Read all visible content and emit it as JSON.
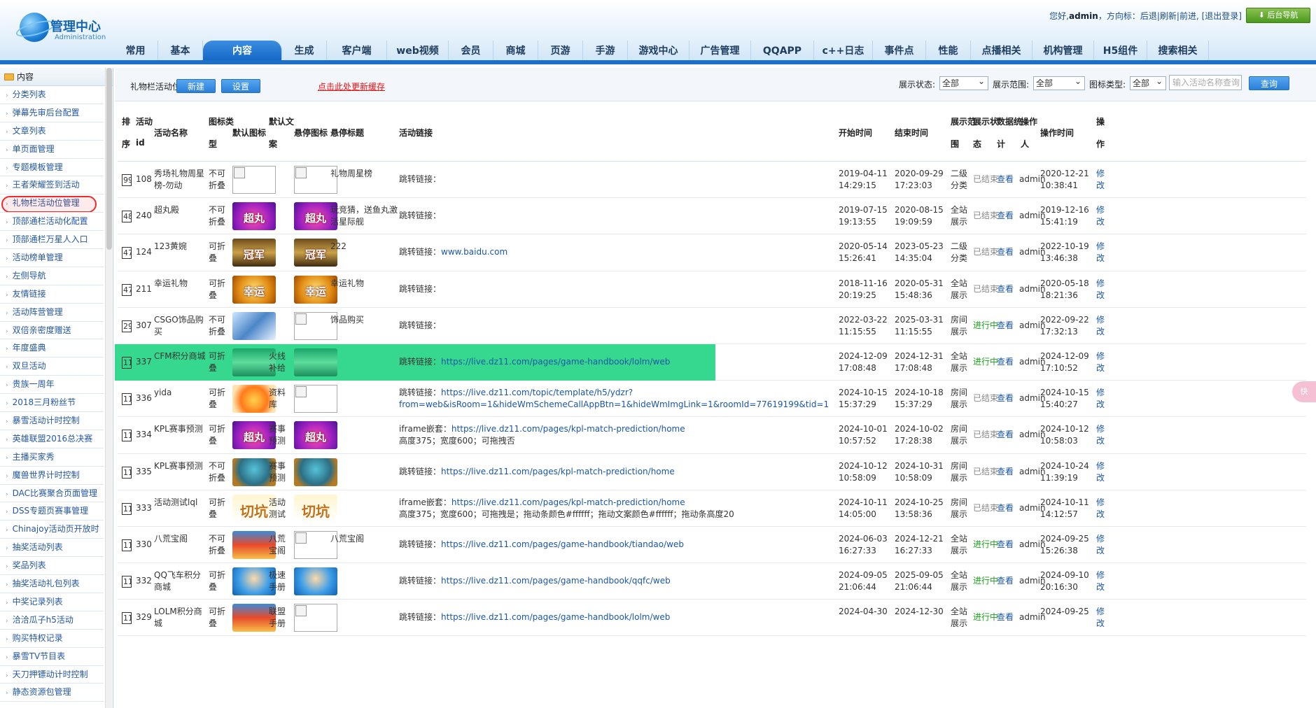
{
  "header": {
    "logo_title": "管理中心",
    "logo_subtitle": "Administration",
    "greeting": "您好,",
    "user": "admin",
    "nav_prefix": "，方向标：",
    "back_link": "后退",
    "refresh_link": "刷新",
    "forward_link": "前进",
    "logout_link": "[退出登录]",
    "backend_nav_button": "后台导航",
    "tabs": [
      "常用",
      "基本",
      "内容",
      "生成",
      "客户端",
      "web视频",
      "会员",
      "商城",
      "页游",
      "手游",
      "游戏中心",
      "广告管理",
      "QQAPP",
      "c++日志",
      "事件点",
      "性能",
      "点播相关",
      "机构管理",
      "H5组件",
      "搜索相关"
    ],
    "active_tab": "内容"
  },
  "sidebar": {
    "section_title": "内容",
    "items": [
      "分类列表",
      "弹幕先审后台配置",
      "文章列表",
      "单页面管理",
      "专题模板管理",
      "王者荣耀签到活动",
      "礼物栏活动位管理",
      "顶部通栏活动化配置",
      "顶部通栏万星人入口",
      "活动榜单管理",
      "左侧导航",
      "友情链接",
      "活动阵营管理",
      "双倍亲密度赠送",
      "年度盛典",
      "双旦活动",
      "贵族一周年",
      "2018三月粉丝节",
      "暴雪活动计时控制",
      "英雄联盟2016总决赛",
      "主播买家秀",
      "魔兽世界计时控制",
      "DAC比赛聚合页面管理",
      "DSS专题页赛事管理",
      "Chinajoy活动页开放时",
      "抽奖活动列表",
      "奖品列表",
      "抽奖活动礼包列表",
      "中奖记录列表",
      "洽洽瓜子h5活动",
      "购买特权记录",
      "暴雪TV节目表",
      "天刀押镖动计时控制",
      "静态资源包管理"
    ]
  },
  "toolbar": {
    "page_label": "礼物栏活动位管理",
    "new_button": "新建",
    "settings_button": "设置",
    "cache_link": "点击此处更新缓存",
    "filter_status_label": "展示状态:",
    "filter_status_value": "全部",
    "filter_range_label": "展示范围:",
    "filter_range_value": "全部",
    "filter_icon_label": "图标类型:",
    "filter_icon_value": "全部",
    "search_placeholder": "输入活动名称查询",
    "query_button": "查询"
  },
  "table": {
    "headers": {
      "seq": [
        "排",
        "序"
      ],
      "id": [
        "活动",
        "id"
      ],
      "name": "活动名称",
      "icon_type": [
        "图标类",
        "型"
      ],
      "default_icon": "默认图标",
      "default_text": [
        "默认文",
        "案"
      ],
      "hover_icon": "悬停图标",
      "hover_title": "悬停标题",
      "link": "活动链接",
      "start": "开始时间",
      "end": "结束时间",
      "range": [
        "展示范",
        "围"
      ],
      "status": [
        "展示状",
        "态"
      ],
      "stats": [
        "数据统",
        "计"
      ],
      "operator": [
        "操作",
        "人"
      ],
      "optime": "操作时间",
      "action": [
        "操",
        "作"
      ]
    },
    "rows": [
      {
        "seq": "99",
        "id": "108",
        "name": "秀场礼物周星榜-勿动",
        "icon_type": "不可折叠",
        "default_icon": "blank",
        "default_text": "",
        "hover_icon": "blank",
        "hover_title": "礼物周星榜",
        "link_prefix": "跳转链接：",
        "link_url": "",
        "link_line2": "",
        "start": [
          "2019-04-11",
          "14:29:15"
        ],
        "end": [
          "2020-09-29",
          "17:23:03"
        ],
        "range": "二级分类",
        "status": "已结束",
        "stats": "查看",
        "operator": "admin",
        "optime": [
          "2020-12-21",
          "10:38:41"
        ],
        "action": "修改"
      },
      {
        "seq": "48",
        "id": "240",
        "name": "超丸殿",
        "icon_type": "不可折叠",
        "default_icon": "超丸",
        "default_text": "",
        "hover_icon": "超丸",
        "hover_title": "玩竞猜，送鱼丸激活星际舰",
        "link_prefix": "跳转链接：",
        "link_url": "",
        "link_line2": "",
        "start": [
          "2019-07-15",
          "19:13:55"
        ],
        "end": [
          "2020-08-15",
          "19:09:59"
        ],
        "range": "全站展示",
        "status": "已结束",
        "stats": "查看",
        "operator": "admin",
        "optime": [
          "2019-12-16",
          "15:41:19"
        ],
        "action": "修改"
      },
      {
        "seq": "47",
        "id": "124",
        "name": "123黄婉",
        "icon_type": "可折叠",
        "default_icon": "冠军",
        "default_text": "",
        "hover_icon": "冠军",
        "hover_title": "222",
        "link_prefix": "跳转链接：",
        "link_url": "www.baidu.com",
        "link_line2": "",
        "start": [
          "2020-05-14",
          "15:26:41"
        ],
        "end": [
          "2023-05-23",
          "14:35:04"
        ],
        "range": "二级分类",
        "status": "已结束",
        "stats": "查看",
        "operator": "admin",
        "optime": [
          "2022-10-19",
          "13:46:38"
        ],
        "action": "修改"
      },
      {
        "seq": "47",
        "id": "211",
        "name": "幸运礼物",
        "icon_type": "可折叠",
        "default_icon": "幸运",
        "default_text": "",
        "hover_icon": "幸运",
        "hover_title": "幸运礼物",
        "link_prefix": "跳转链接：",
        "link_url": "",
        "link_line2": "",
        "start": [
          "2018-11-16",
          "20:19:25"
        ],
        "end": [
          "2020-05-31",
          "15:48:36"
        ],
        "range": "全站展示",
        "status": "已结束",
        "stats": "查看",
        "operator": "admin",
        "optime": [
          "2020-05-18",
          "18:21:36"
        ],
        "action": "修改"
      },
      {
        "seq": "29",
        "id": "307",
        "name": "CSGO饰品购买",
        "icon_type": "不可折叠",
        "default_icon": "csgo",
        "default_text": "",
        "hover_icon": "blank",
        "hover_title": "饰品购买",
        "link_prefix": "跳转链接：",
        "link_url": "",
        "link_line2": "",
        "start": [
          "2022-03-22",
          "11:15:55"
        ],
        "end": [
          "2025-03-31",
          "11:15:55"
        ],
        "range": "房间展示",
        "status": "进行中",
        "stats": "查看",
        "operator": "admin",
        "optime": [
          "2022-09-22",
          "17:32:13"
        ],
        "action": "修改"
      },
      {
        "seq": "11",
        "id": "337",
        "name": "CFM积分商城",
        "icon_type": "可折叠",
        "default_icon": "green",
        "default_text": "火线补给",
        "hover_icon": "green",
        "hover_title": "",
        "link_prefix": "跳转链接：",
        "link_url": "https://live.dz11.com/pages/game-handbook/lolm/web",
        "link_line2": "",
        "start": [
          "2024-12-09",
          "17:08:48"
        ],
        "end": [
          "2024-12-31",
          "17:08:48"
        ],
        "range": "全站展示",
        "status": "进行中",
        "stats": "查看",
        "operator": "admin",
        "optime": [
          "2024-12-09",
          "17:10:52"
        ],
        "action": "修改",
        "highlight": true
      },
      {
        "seq": "11",
        "id": "336",
        "name": "yida",
        "icon_type": "可折叠",
        "default_icon": "sun",
        "default_text": "资料库",
        "hover_icon": "blank",
        "hover_title": "",
        "link_prefix": "跳转链接：",
        "link_url": "https://live.dz11.com/topic/template/h5/ydzr?",
        "link_line2": "from=web&isRoom=1&hideWmSchemeCallAppBtn=1&hideWmImgLink=1&roomId=77619199&tid=1",
        "start": [
          "2024-10-15",
          "15:37:29"
        ],
        "end": [
          "2024-10-18",
          "15:37:29"
        ],
        "range": "房间展示",
        "status": "已结束",
        "stats": "查看",
        "operator": "admin",
        "optime": [
          "2024-10-15",
          "15:40:27"
        ],
        "action": "修改"
      },
      {
        "seq": "11",
        "id": "334",
        "name": "KPL赛事预测",
        "icon_type": "可折叠",
        "default_icon": "超丸",
        "default_text": "赛事预测",
        "hover_icon": "超丸",
        "hover_title": "",
        "link_prefix": "iframe嵌套：",
        "link_url": "https://live.dz11.com/pages/kpl-match-prediction/home",
        "link_line2": "高度375；宽度600；可拖拽否",
        "start": [
          "2024-10-01",
          "10:57:52"
        ],
        "end": [
          "2024-10-02",
          "17:28:38"
        ],
        "range": "房间展示",
        "status": "已结束",
        "stats": "查看",
        "operator": "admin",
        "optime": [
          "2024-10-12",
          "10:58:03"
        ],
        "action": "修改"
      },
      {
        "seq": "11",
        "id": "335",
        "name": "KPL赛事预测",
        "icon_type": "不可折叠",
        "default_icon": "helmet",
        "default_text": "赛事预测",
        "hover_icon": "helmet",
        "hover_title": "",
        "link_prefix": "跳转链接：",
        "link_url": "https://live.dz11.com/pages/kpl-match-prediction/home",
        "link_line2": "",
        "start": [
          "2024-10-12",
          "10:58:09"
        ],
        "end": [
          "2024-10-31",
          "10:58:09"
        ],
        "range": "房间展示",
        "status": "已结束",
        "stats": "查看",
        "operator": "admin",
        "optime": [
          "2024-10-24",
          "11:39:19"
        ],
        "action": "修改"
      },
      {
        "seq": "11",
        "id": "333",
        "name": "活动测试lql",
        "icon_type": "可折叠",
        "default_icon": "切坑",
        "default_text": "活动测试",
        "hover_icon": "切坑",
        "hover_title": "",
        "link_prefix": "iframe嵌套：",
        "link_url": "https://live.dz11.com/pages/kpl-match-prediction/home",
        "link_line2": "高度375；宽度600；可拖拽是；拖动条颜色#ffffff；拖动文案颜色#ffffff；拖动条高度20",
        "start": [
          "2024-10-11",
          "14:05:00"
        ],
        "end": [
          "2024-10-25",
          "13:58:36"
        ],
        "range": "房间展示",
        "status": "已结束",
        "stats": "查看",
        "operator": "admin",
        "optime": [
          "2024-10-11",
          "14:12:57"
        ],
        "action": "修改"
      },
      {
        "seq": "11",
        "id": "330",
        "name": "八荒宝阁",
        "icon_type": "不可折叠",
        "default_icon": "temple",
        "default_text": "八荒宝阁",
        "hover_icon": "blank",
        "hover_title": "八荒宝阁",
        "link_prefix": "跳转链接：",
        "link_url": "https://live.dz11.com/pages/game-handbook/tiandao/web",
        "link_line2": "",
        "start": [
          "2024-06-03",
          "16:27:33"
        ],
        "end": [
          "2024-12-21",
          "16:27:33"
        ],
        "range": "全站展示",
        "status": "进行中",
        "stats": "查看",
        "operator": "admin",
        "optime": [
          "2024-09-25",
          "15:26:38"
        ],
        "action": "修改"
      },
      {
        "seq": "11",
        "id": "332",
        "name": "QQ飞车积分商城",
        "icon_type": "可折叠",
        "default_icon": "racer",
        "default_text": "极速手册",
        "hover_icon": "racer",
        "hover_title": "",
        "link_prefix": "跳转链接：",
        "link_url": "https://live.dz11.com/pages/game-handbook/qqfc/web",
        "link_line2": "",
        "start": [
          "2024-09-05",
          "21:06:44"
        ],
        "end": [
          "2025-09-05",
          "21:06:44"
        ],
        "range": "全站展示",
        "status": "进行中",
        "stats": "查看",
        "operator": "admin",
        "optime": [
          "2024-09-10",
          "20:16:30"
        ],
        "action": "修改"
      },
      {
        "seq": "11",
        "id": "329",
        "name": "LOLM积分商城",
        "icon_type": "可折叠",
        "default_icon": "temple",
        "default_text": "联盟手册",
        "hover_icon": "blank",
        "hover_title": "",
        "link_prefix": "跳转链接：",
        "link_url": "https://live.dz11.com/pages/game-handbook/lolm/web",
        "link_line2": "",
        "start": [
          "2024-04-30",
          ""
        ],
        "end": [
          "2024-12-30",
          ""
        ],
        "range": "全站展示",
        "status": "进行中",
        "stats": "查看",
        "operator": "admin",
        "optime": [
          "2024-09-25",
          ""
        ],
        "action": "修改"
      }
    ]
  },
  "right_badge": "快"
}
